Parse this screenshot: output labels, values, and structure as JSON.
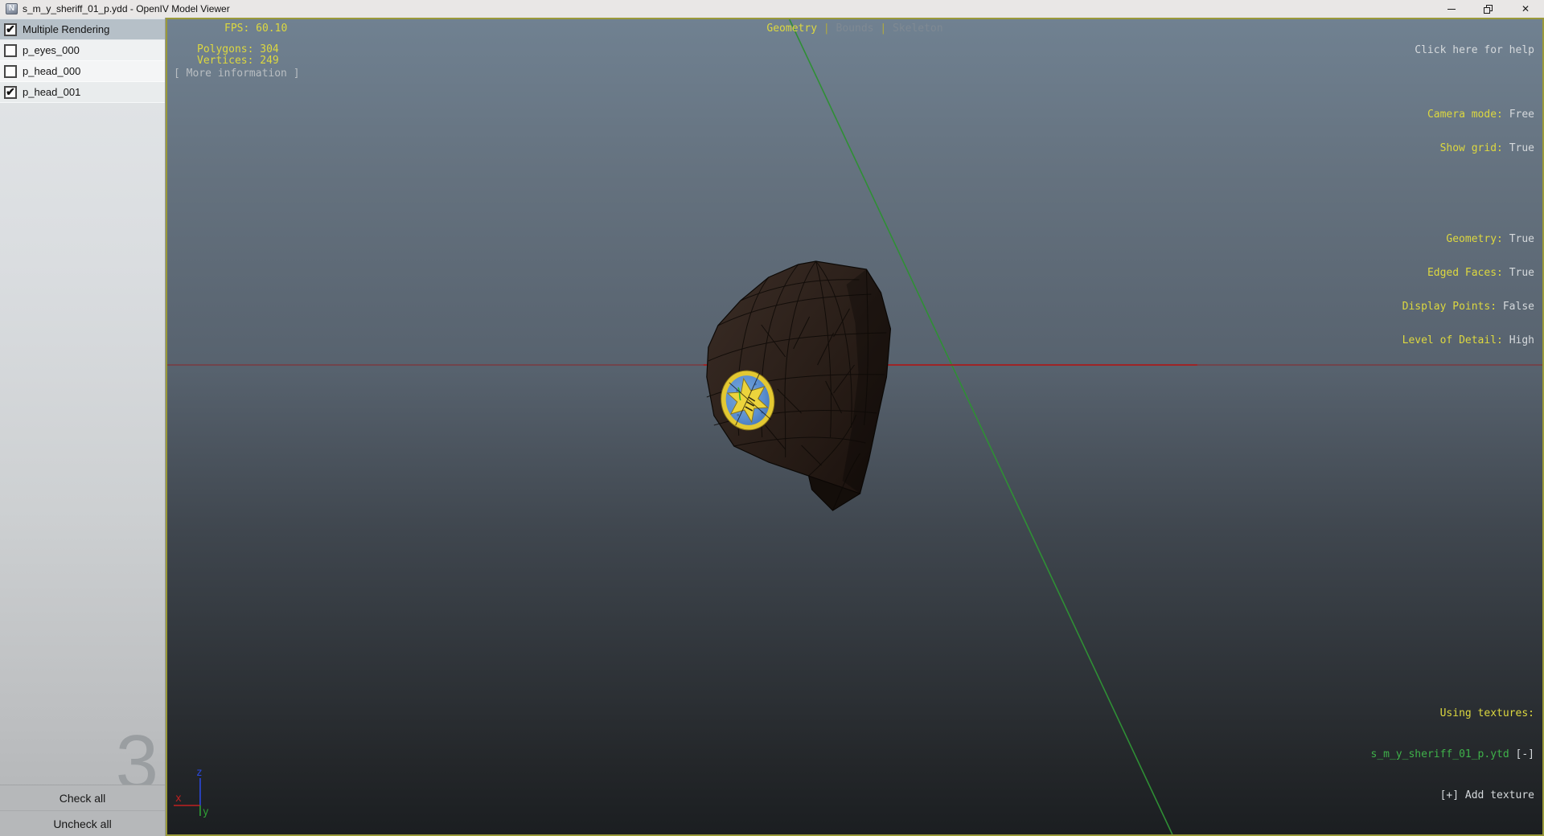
{
  "window": {
    "title": "s_m_y_sheriff_01_p.ydd - OpenIV Model Viewer",
    "icon_letter": "N",
    "controls": {
      "close_glyph": "✕"
    }
  },
  "sidebar": {
    "check_glyph": "✔",
    "items": [
      {
        "label": "Multiple Rendering",
        "checked": true,
        "selected": true
      },
      {
        "label": "p_eyes_000",
        "checked": false
      },
      {
        "label": "p_head_000",
        "checked": false
      },
      {
        "label": "p_head_001",
        "checked": true
      }
    ],
    "watermark": "3",
    "check_all": "Check all",
    "uncheck_all": "Uncheck all"
  },
  "viewport": {
    "stats": {
      "fps": "FPS: 60.10",
      "polygons": "Polygons: 304",
      "vertices": "Vertices: 249",
      "more_info": "[ More information ]"
    },
    "tabs_separator": "|",
    "tabs": [
      {
        "label": "Geometry",
        "active": true
      },
      {
        "label": "Bounds",
        "active": false
      },
      {
        "label": "Skeleton",
        "active": false
      }
    ],
    "help": "Click here for help",
    "settings": [
      {
        "label": "Camera mode:",
        "value": "Free"
      },
      {
        "label": "Show grid:",
        "value": "True"
      },
      {
        "label": "Geometry:",
        "value": "True"
      },
      {
        "label": "Edged Faces:",
        "value": "True"
      },
      {
        "label": "Display Points:",
        "value": "False"
      },
      {
        "label": "Level of Detail:",
        "value": "High"
      }
    ],
    "textures": {
      "heading": "Using textures:",
      "file": "s_m_y_sheriff_01_p.ytd",
      "remove": "[-]",
      "add": "[+] Add texture"
    },
    "axis_labels": {
      "x": "x",
      "y": "y",
      "z": "z"
    },
    "colors": {
      "overlay_yellow": "#ddd83f",
      "overlay_value": "#d5d9dc",
      "texture_green": "#3fb24a",
      "grid_red_bright": "#a61f1f",
      "grid_red_dim": "#7a3b41",
      "grid_green": "#2f8f35",
      "axis_blue": "#2a48e0",
      "viewport_border": "#9a9a3a",
      "badge_yellow": "#e3c832",
      "badge_blue": "#5b8fd0"
    }
  }
}
